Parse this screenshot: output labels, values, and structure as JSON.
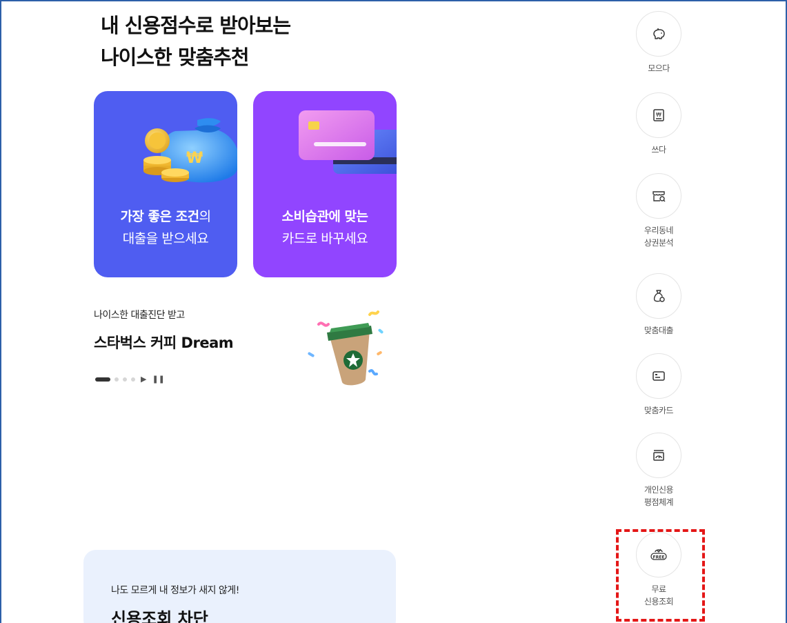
{
  "headline": {
    "line1": "내 신용점수로 받아보는",
    "line2": "나이스한 맞춤추천"
  },
  "cards": {
    "loan": {
      "bold": "가장 좋은 조건",
      "rest": "의",
      "line2": "대출을 받으세요",
      "color": "#4f5df1"
    },
    "card": {
      "bold": "소비습관에 맞는",
      "line2": "카드로 바꾸세요",
      "color": "#9145ff"
    }
  },
  "promo": {
    "subtitle": "나이스한 대출진단 받고",
    "title": "스타벅스 커피 Dream",
    "play_icon": "play-icon",
    "pause_icon": "pause-icon"
  },
  "bottom_card": {
    "subtitle": "나도 모르게 내 정보가 새지 않게!",
    "title": "신용조회 차단"
  },
  "side_menu": [
    {
      "label1": "모으다",
      "label2": "",
      "icon": "piggy-bank-icon"
    },
    {
      "label1": "쓰다",
      "label2": "",
      "icon": "receipt-icon"
    },
    {
      "label1": "우리동네",
      "label2": "상권분석",
      "icon": "store-search-icon"
    },
    {
      "label1": "맞춤대출",
      "label2": "",
      "icon": "money-bag-icon"
    },
    {
      "label1": "맞춤카드",
      "label2": "",
      "icon": "credit-card-icon"
    },
    {
      "label1": "개인신용",
      "label2": "평점체계",
      "icon": "credit-gauge-icon"
    },
    {
      "label1": "무료",
      "label2": "신용조회",
      "icon": "free-check-icon"
    }
  ],
  "colors": {
    "highlight": "#e41717",
    "border": "#2d5fa8"
  }
}
